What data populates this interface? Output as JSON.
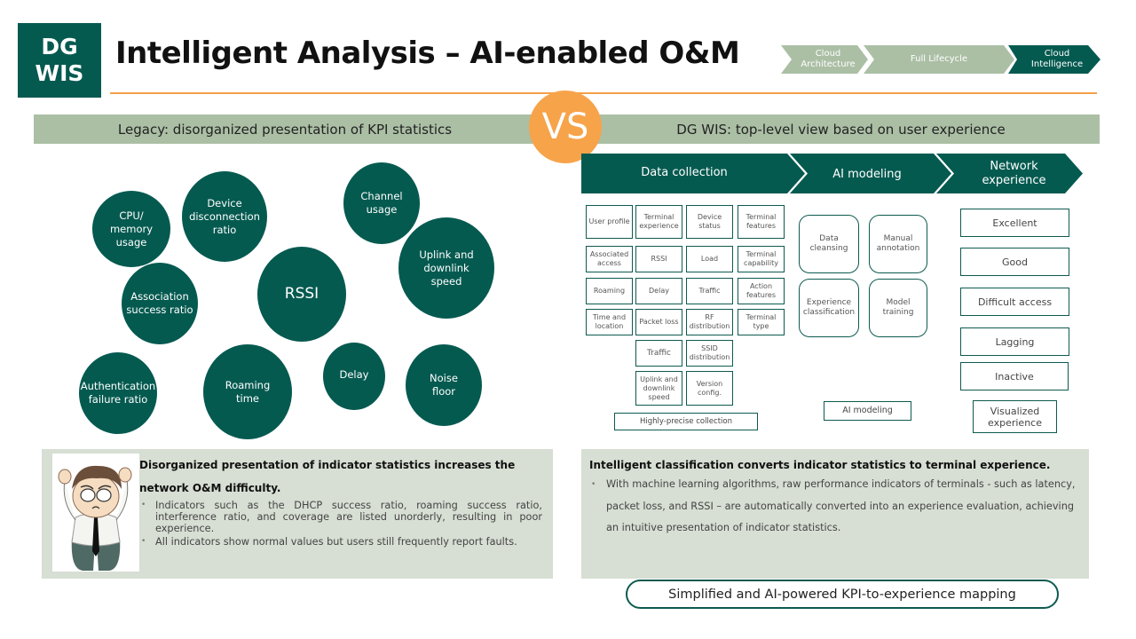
{
  "logo": {
    "line1": "DG",
    "line2": "WIS"
  },
  "title": "Intelligent Analysis – AI-enabled O&M",
  "breadcrumb": [
    {
      "label": "Cloud Architecture",
      "active": false
    },
    {
      "label": "Full Lifecycle",
      "active": false
    },
    {
      "label": "Cloud Intelligence",
      "active": true
    }
  ],
  "colors": {
    "brand": "#055a50",
    "accent": "#f7a34a",
    "band": "#abbfa5",
    "panel": "#d7ded3",
    "inactive_step": "#abbfa5"
  },
  "legacy": {
    "heading": "Legacy: disorganized presentation of KPI statistics",
    "bubbles": [
      {
        "label": "CPU/ memory usage"
      },
      {
        "label": "Device disconnection ratio"
      },
      {
        "label": "Channel usage"
      },
      {
        "label": "Uplink and downlink speed"
      },
      {
        "label": "Association success ratio"
      },
      {
        "label": "RSSI"
      },
      {
        "label": "Authentication failure ratio"
      },
      {
        "label": "Roaming time"
      },
      {
        "label": "Delay"
      },
      {
        "label": "Noise floor"
      }
    ],
    "panel": {
      "illustration": "frustrated-engineer-illustration",
      "heading": "Disorganized presentation of indicator statistics increases the network O&M difficulty.",
      "bullets": [
        "Indicators such as the DHCP success ratio, roaming success ratio, interference ratio, and coverage are listed unorderly, resulting in poor experience.",
        "All indicators show normal values but users still frequently report faults."
      ]
    }
  },
  "vs_label": "VS",
  "dgwis": {
    "heading": "DG WIS: top-level view based on user experience",
    "steps": [
      "Data collection",
      "AI modeling",
      "Network experience"
    ],
    "data_collection": {
      "cells": [
        "User profile",
        "Terminal experience",
        "Device status",
        "Terminal features",
        "Associated access",
        "RSSI",
        "Load",
        "Terminal capability",
        "Roaming",
        "Delay",
        "Traffic",
        "Action features",
        "Time and location",
        "Packet loss",
        "RF distribution",
        "Terminal type",
        "Traffic",
        "SSID distribution",
        "Uplink and downlink speed",
        "Version config."
      ],
      "caption": "Highly-precise collection"
    },
    "ai_modeling": {
      "cells": [
        "Data cleansing",
        "Manual annotation",
        "Experience classification",
        "Model training"
      ],
      "caption": "AI modeling"
    },
    "network_experience": {
      "levels": [
        "Excellent",
        "Good",
        "Difficult access",
        "Lagging",
        "Inactive"
      ],
      "caption": "Visualized experience"
    },
    "panel": {
      "heading": "Intelligent classification converts indicator statistics to terminal experience.",
      "bullets": [
        "With machine learning algorithms, raw performance indicators of terminals - such as latency, packet loss, and RSSI – are automatically converted into an experience evaluation, achieving an intuitive presentation of indicator statistics."
      ]
    },
    "summary": "Simplified and AI-powered KPI-to-experience mapping"
  }
}
